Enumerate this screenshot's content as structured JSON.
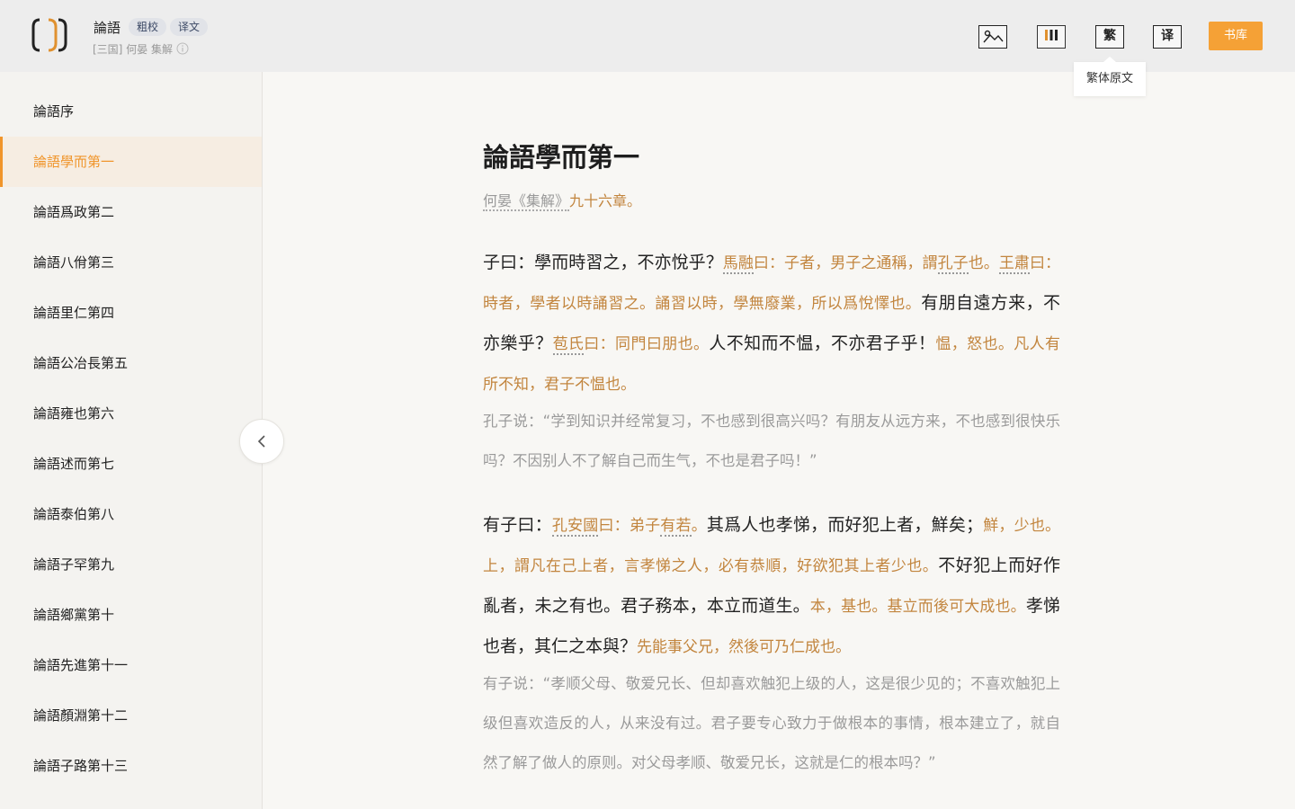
{
  "header": {
    "book_title": "論語",
    "tags": [
      "粗校",
      "译文"
    ],
    "subtitle": "[三国] 何晏 集解",
    "tools": {
      "fan_label": "繁",
      "yi_label": "译"
    },
    "library_button": "书库",
    "tooltip": "繁体原文"
  },
  "sidebar": {
    "items": [
      {
        "label": "論語序"
      },
      {
        "label": "論語學而第一"
      },
      {
        "label": "論語爲政第二"
      },
      {
        "label": "論語八佾第三"
      },
      {
        "label": "論語里仁第四"
      },
      {
        "label": "論語公冶長第五"
      },
      {
        "label": "論語雍也第六"
      },
      {
        "label": "論語述而第七"
      },
      {
        "label": "論語泰伯第八"
      },
      {
        "label": "論語子罕第九"
      },
      {
        "label": "論語鄉黨第十"
      },
      {
        "label": "論語先進第十一"
      },
      {
        "label": "論語顏淵第十二"
      },
      {
        "label": "論語子路第十三"
      }
    ],
    "active_index": 1
  },
  "chapter": {
    "title": "論語學而第一",
    "note_source": "何晏《集解》",
    "note_count": "九十六章。",
    "p1": {
      "a": "子曰：學而時習之，不亦悅乎？",
      "b_u": "馬融",
      "b": "曰：子者，男子之通稱，謂",
      "c_u": "孔子",
      "c": "也。",
      "d_u": "王肅",
      "e": "曰：時者，學者以時誦習之。誦習以時，學無廢業，所以爲悅懌也。",
      "f": "有朋自遠方来，不亦樂乎？",
      "g_u": "苞氏",
      "g": "曰：同門曰朋也。",
      "h": "人不知而不愠，不亦君子乎！",
      "i": "愠，怒也。凡人有所不知，君子不愠也。"
    },
    "t1": "孔子说：“学到知识并经常复习，不也感到很高兴吗？有朋友从远方来，不也感到很快乐吗？不因别人不了解自己而生气，不也是君子吗！”",
    "p2": {
      "a": "有子曰：",
      "b_u": "孔安國",
      "b": "曰：弟子",
      "c_u": "有若",
      "c": "。",
      "d": "其爲人也孝悌，而好犯上者，鮮矣；",
      "e": "鮮，少也。上，謂凡在己上者，言孝悌之人，必有恭順，好欲犯其上者少也。",
      "f": "不好犯上而好作亂者，未之有也。君子務本，本立而道生。",
      "g": "本，基也。基立而後可大成也。",
      "h": "孝悌也者，其仁之本與？",
      "i": "先能事父兄，然後可乃仁成也。"
    },
    "t2": "有子说：“孝顺父母、敬爱兄长、但却喜欢触犯上级的人，这是很少见的；不喜欢触犯上级但喜欢造反的人，从来没有过。君子要专心致力于做根本的事情，根本建立了，就自然了解了做人的原则。对父母孝顺、敬爱兄长，这就是仁的根本吗？”"
  }
}
